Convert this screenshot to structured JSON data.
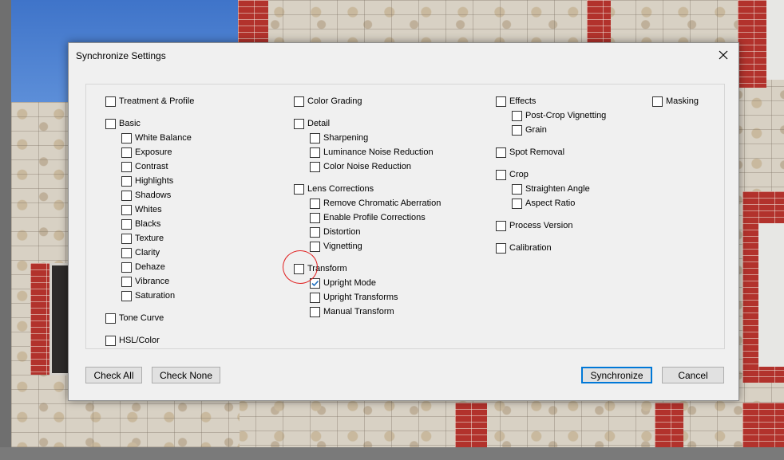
{
  "dialog": {
    "title": "Synchronize Settings",
    "columns": [
      [
        {
          "label": "Treatment & Profile",
          "checked": false,
          "level": 0
        },
        {
          "label": "Basic",
          "checked": false,
          "level": 0,
          "gap": true
        },
        {
          "label": "White Balance",
          "checked": false,
          "level": 1
        },
        {
          "label": "Exposure",
          "checked": false,
          "level": 1
        },
        {
          "label": "Contrast",
          "checked": false,
          "level": 1
        },
        {
          "label": "Highlights",
          "checked": false,
          "level": 1
        },
        {
          "label": "Shadows",
          "checked": false,
          "level": 1
        },
        {
          "label": "Whites",
          "checked": false,
          "level": 1
        },
        {
          "label": "Blacks",
          "checked": false,
          "level": 1
        },
        {
          "label": "Texture",
          "checked": false,
          "level": 1
        },
        {
          "label": "Clarity",
          "checked": false,
          "level": 1
        },
        {
          "label": "Dehaze",
          "checked": false,
          "level": 1
        },
        {
          "label": "Vibrance",
          "checked": false,
          "level": 1
        },
        {
          "label": "Saturation",
          "checked": false,
          "level": 1
        },
        {
          "label": "Tone Curve",
          "checked": false,
          "level": 0,
          "gap": true
        },
        {
          "label": "HSL/Color",
          "checked": false,
          "level": 0,
          "gap": true
        }
      ],
      [
        {
          "label": "Color Grading",
          "checked": false,
          "level": 0
        },
        {
          "label": "Detail",
          "checked": false,
          "level": 0,
          "gap": true
        },
        {
          "label": "Sharpening",
          "checked": false,
          "level": 1
        },
        {
          "label": "Luminance Noise Reduction",
          "checked": false,
          "level": 1
        },
        {
          "label": "Color Noise Reduction",
          "checked": false,
          "level": 1
        },
        {
          "label": "Lens Corrections",
          "checked": false,
          "level": 0,
          "gap": true
        },
        {
          "label": "Remove Chromatic Aberration",
          "checked": false,
          "level": 1
        },
        {
          "label": "Enable Profile Corrections",
          "checked": false,
          "level": 1
        },
        {
          "label": "Distortion",
          "checked": false,
          "level": 1
        },
        {
          "label": "Vignetting",
          "checked": false,
          "level": 1
        },
        {
          "label": "Transform",
          "checked": false,
          "level": 0,
          "gap": true
        },
        {
          "label": "Upright Mode",
          "checked": true,
          "level": 1
        },
        {
          "label": "Upright Transforms",
          "checked": false,
          "level": 1
        },
        {
          "label": "Manual Transform",
          "checked": false,
          "level": 1
        }
      ],
      [
        {
          "label": "Effects",
          "checked": false,
          "level": 0
        },
        {
          "label": "Post-Crop Vignetting",
          "checked": false,
          "level": 1
        },
        {
          "label": "Grain",
          "checked": false,
          "level": 1
        },
        {
          "label": "Spot Removal",
          "checked": false,
          "level": 0,
          "gap": true
        },
        {
          "label": "Crop",
          "checked": false,
          "level": 0,
          "gap": true
        },
        {
          "label": "Straighten Angle",
          "checked": false,
          "level": 1
        },
        {
          "label": "Aspect Ratio",
          "checked": false,
          "level": 1
        },
        {
          "label": "Process Version",
          "checked": false,
          "level": 0,
          "gap": true
        },
        {
          "label": "Calibration",
          "checked": false,
          "level": 0,
          "gap": true
        }
      ],
      [
        {
          "label": "Masking",
          "checked": false,
          "level": 0
        }
      ]
    ],
    "buttons": {
      "check_all": "Check All",
      "check_none": "Check None",
      "synchronize": "Synchronize",
      "cancel": "Cancel"
    }
  },
  "colors": {
    "checkmark": "#1f6fbf",
    "annotation": "#e02020",
    "focus_border": "#0078d7"
  }
}
